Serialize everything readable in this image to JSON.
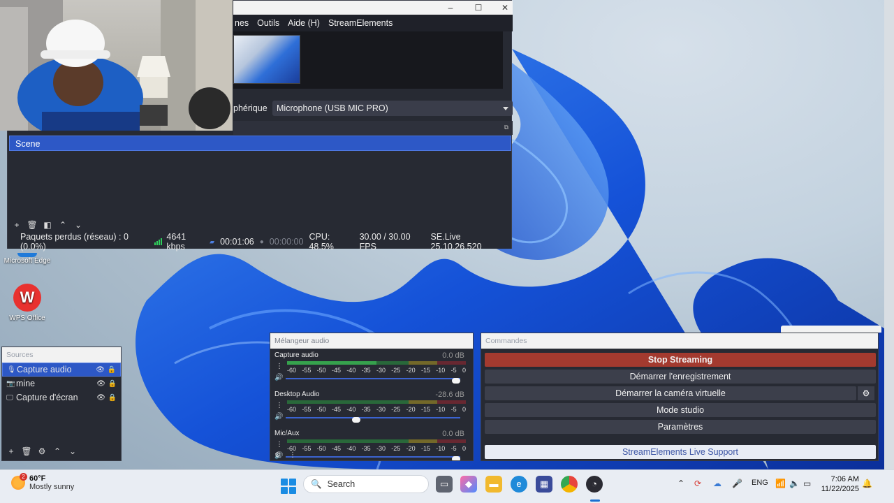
{
  "obs": {
    "menu": [
      "nes",
      "Outils",
      "Aide (H)",
      "StreamElements"
    ],
    "device_label": "phérique",
    "device_value": "Microphone (USB MIC PRO)",
    "scenes": [
      "Scene"
    ],
    "status": {
      "dropped": "Paquets perdus (réseau) : 0 (0.0%)",
      "bitrate": "4641 kbps",
      "stream_time": "00:01:06",
      "rec_time": "00:00:00",
      "cpu": "CPU: 48.5%",
      "fps": "30.00 / 30.00 FPS",
      "version": "SE.Live 25.10.26.520"
    }
  },
  "desktop_icons": [
    {
      "label": "Microsoft Edge",
      "icon": "edge-icon"
    },
    {
      "label": "WPS Office",
      "icon": "wps-icon"
    }
  ],
  "sources": {
    "title": "Sources",
    "items": [
      {
        "label": "Capture audio",
        "icon": "mic-icon",
        "selected": true
      },
      {
        "label": "mine",
        "icon": "camera-icon",
        "selected": false
      },
      {
        "label": "Capture d'écran",
        "icon": "monitor-icon",
        "selected": false
      }
    ]
  },
  "mixer": {
    "title": "Mélangeur audio",
    "scale": [
      "-60",
      "-55",
      "-50",
      "-45",
      "-40",
      "-35",
      "-30",
      "-25",
      "-20",
      "-15",
      "-10",
      "-5",
      "0"
    ],
    "channels": [
      {
        "name": "Capture audio",
        "db": "0.0 dB",
        "level": 0.5,
        "volume": 1.0
      },
      {
        "name": "Desktop Audio",
        "db": "-28.6 dB",
        "level": 0.0,
        "volume": 0.4
      },
      {
        "name": "Mic/Aux",
        "db": "0.0 dB",
        "level": 0.0,
        "volume": 1.0
      }
    ]
  },
  "controls": {
    "title": "Commandes",
    "stop_streaming": "Stop Streaming",
    "start_recording": "Démarrer l'enregistrement",
    "virtual_cam": "Démarrer la caméra virtuelle",
    "studio_mode": "Mode studio",
    "settings": "Paramètres",
    "support": "StreamElements Live Support"
  },
  "taskbar": {
    "temp": "60°F",
    "condition": "Mostly sunny",
    "weather_badge": "2",
    "search_placeholder": "Search",
    "language": "ENG",
    "time": "7:06 AM",
    "date": "11/22/2025"
  },
  "colors": {
    "accent": "#2d58c6",
    "stop": "#a33a2f",
    "bitrate_ok": "#2fd05d"
  }
}
